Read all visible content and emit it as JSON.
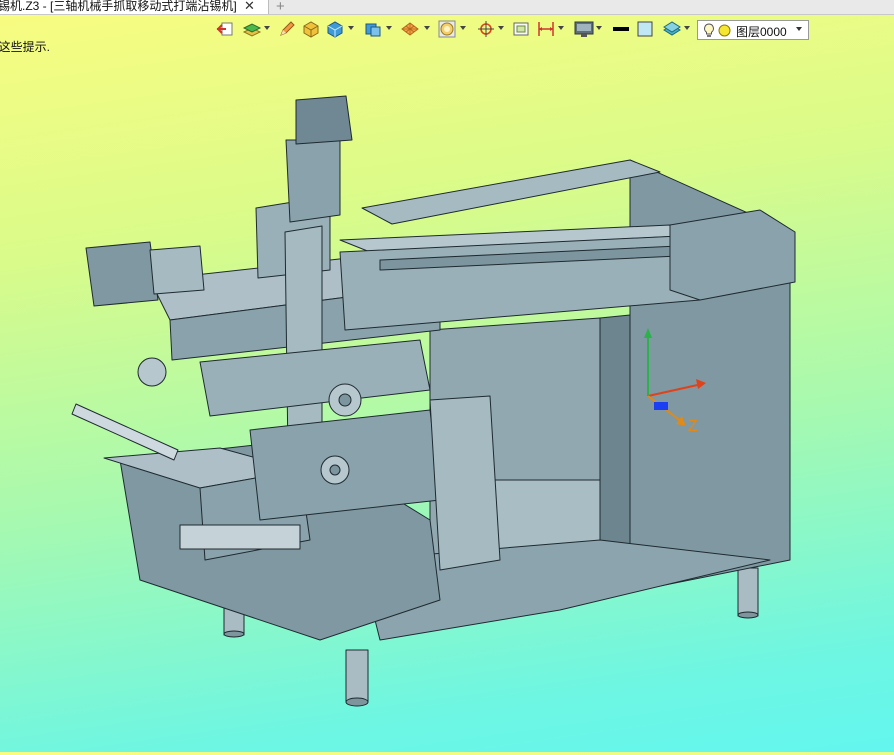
{
  "window": {
    "tab_title": "锡机.Z3 - [三轴机械手抓取移动式打端沾锡机]",
    "close_glyph": "✕",
    "new_tab_glyph": "+"
  },
  "hint": {
    "text": "i这些提示."
  },
  "toolbar": {
    "icons": [
      "exit-sketch-icon",
      "layer-stack-icon",
      "pencil-icon",
      "box-icon",
      "cube-icon",
      "solid-view-icon",
      "render-mode-icon",
      "view-sphere-icon",
      "circle-view-icon",
      "snap-target-icon",
      "frame-icon",
      "dimension-icon",
      "monitor-icon",
      "line-color-swatch",
      "fill-color-swatch",
      "material-icon",
      "lightbulb-icon"
    ]
  },
  "layer": {
    "label": "图层0000",
    "dot_color": "#f5e632"
  },
  "triad": {
    "z_label": "Z",
    "colors": {
      "x": "#e0421a",
      "y": "#2bb24a",
      "z": "#e08a1a"
    }
  },
  "model": {
    "body_color": "#8aa3ad",
    "edge_color": "#1e2a30"
  }
}
